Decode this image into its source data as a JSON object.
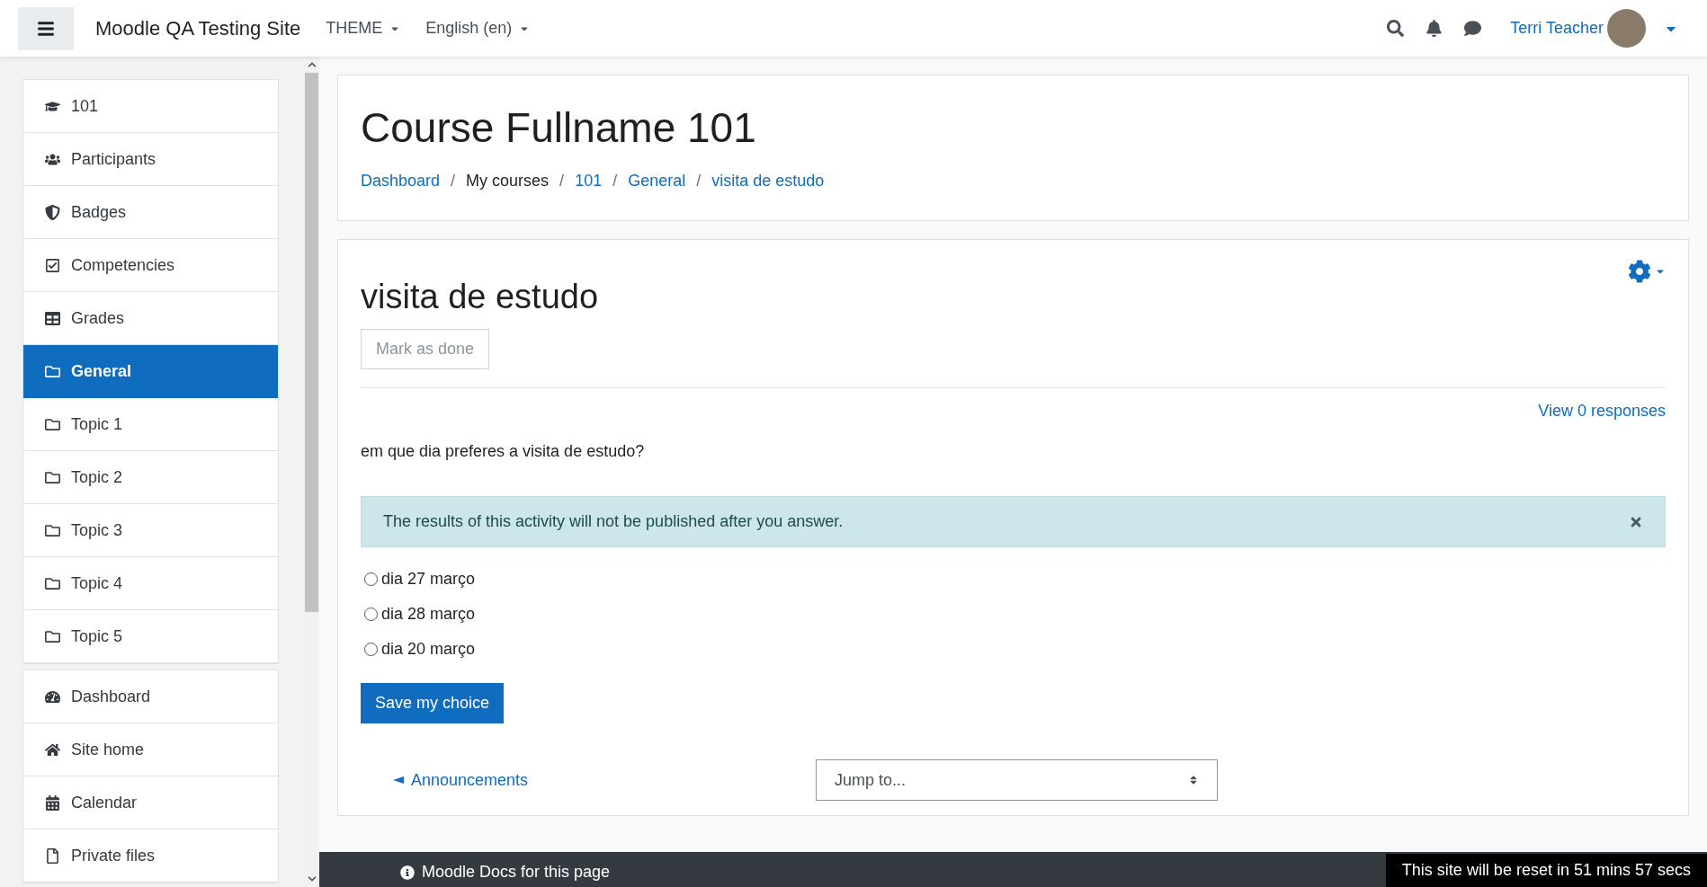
{
  "header": {
    "site_name": "Moodle QA Testing Site",
    "menus": [
      {
        "label": "THEME"
      },
      {
        "label": "English (en)"
      }
    ],
    "user": {
      "name": "Terri Teacher"
    }
  },
  "sidebar": {
    "groups": [
      {
        "items": [
          {
            "label": "101",
            "selected": false
          },
          {
            "label": "Participants",
            "selected": false
          },
          {
            "label": "Badges",
            "selected": false
          },
          {
            "label": "Competencies",
            "selected": false
          },
          {
            "label": "Grades",
            "selected": false
          },
          {
            "label": "General",
            "selected": true
          },
          {
            "label": "Topic 1",
            "selected": false
          },
          {
            "label": "Topic 2",
            "selected": false
          },
          {
            "label": "Topic 3",
            "selected": false
          },
          {
            "label": "Topic 4",
            "selected": false
          },
          {
            "label": "Topic 5",
            "selected": false
          }
        ]
      },
      {
        "items": [
          {
            "label": "Dashboard",
            "selected": false
          },
          {
            "label": "Site home",
            "selected": false
          },
          {
            "label": "Calendar",
            "selected": false
          },
          {
            "label": "Private files",
            "selected": false
          }
        ]
      }
    ]
  },
  "page_header": {
    "title": "Course Fullname 101",
    "breadcrumb": [
      {
        "label": "Dashboard",
        "kind": "link"
      },
      {
        "label": "/",
        "kind": "separator"
      },
      {
        "label": "My courses",
        "kind": "text"
      },
      {
        "label": "/",
        "kind": "separator"
      },
      {
        "label": "101",
        "kind": "link"
      },
      {
        "label": "/",
        "kind": "separator"
      },
      {
        "label": "General",
        "kind": "link"
      },
      {
        "label": "/",
        "kind": "separator"
      },
      {
        "label": "visita de estudo",
        "kind": "link"
      }
    ]
  },
  "activity": {
    "title": "visita de estudo",
    "mark_button": "Mark as done",
    "responses_link": "View 0 responses",
    "question": "em que dia preferes a visita de estudo?",
    "alert": "The results of this activity will not be published after you answer.",
    "options": [
      {
        "label": "dia 27 março",
        "selected": false
      },
      {
        "label": "dia 28 março",
        "selected": false
      },
      {
        "label": "dia 20 março",
        "selected": false
      }
    ],
    "submit": "Save my choice",
    "prev_link": "Announcements",
    "jump": {
      "placeholder": "Jump to..."
    }
  },
  "footer": {
    "docs_link": "Moodle Docs for this page",
    "reset_notice": "This site will be reset in 51 mins 57 secs"
  }
}
